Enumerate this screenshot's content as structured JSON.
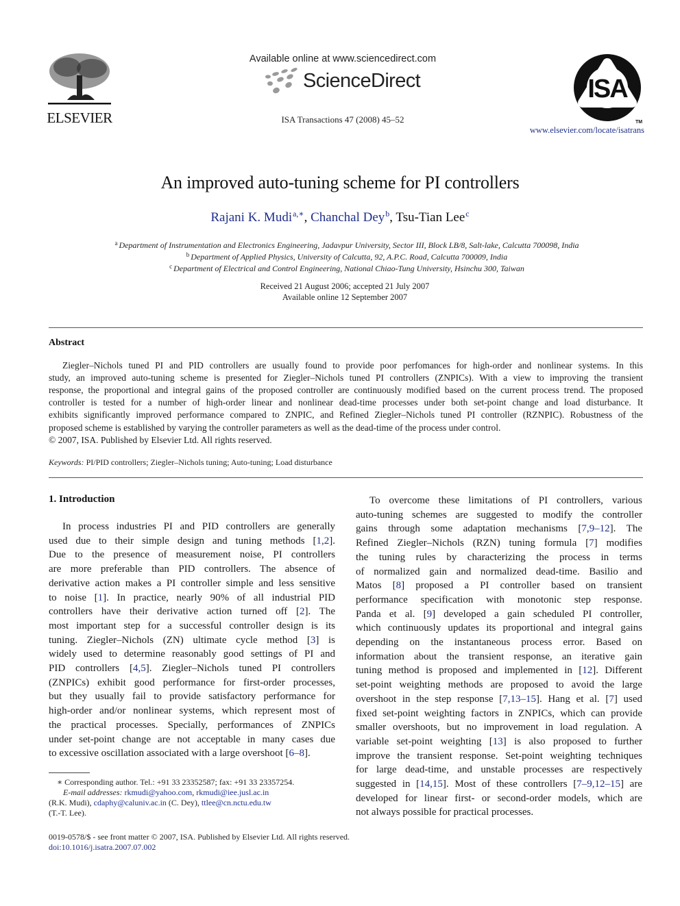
{
  "header": {
    "publisher": "ELSEVIER",
    "available_online": "Available online at www.sciencedirect.com",
    "sciencedirect_brand": "ScienceDirect",
    "journal_ref": "ISA Transactions 47 (2008) 45–52",
    "isa_logo_text": "ISA",
    "isa_tm": "TM",
    "journal_url": "www.elsevier.com/locate/isatrans"
  },
  "article": {
    "title": "An improved auto-tuning scheme for PI controllers",
    "authors": [
      {
        "name": "Rajani K. Mudi",
        "sup": "a,∗",
        "linked": true
      },
      {
        "name": "Chanchal Dey",
        "sup": "b",
        "linked": true
      },
      {
        "name": "Tsu-Tian Lee",
        "sup": "c",
        "linked": false
      }
    ],
    "affiliations": [
      {
        "sup": "a",
        "text": "Department of Instrumentation and Electronics Engineering, Jadavpur University, Sector III, Block LB/8, Salt-lake, Calcutta 700098, India"
      },
      {
        "sup": "b",
        "text": "Department of Applied Physics, University of Calcutta, 92, A.P.C. Road, Calcutta 700009, India"
      },
      {
        "sup": "c",
        "text": "Department of Electrical and Control Engineering, National Chiao-Tung University, Hsinchu 300, Taiwan"
      }
    ],
    "received": "Received 21 August 2006; accepted 21 July 2007",
    "available": "Available online 12 September 2007"
  },
  "abstract": {
    "heading": "Abstract",
    "lines": [
      "Ziegler–Nichols tuned PI and PID controllers are usually found to provide poor perfomances for high-order and nonlinear systems. In this",
      "study, an improved auto-tuning scheme is presented for Ziegler–Nichols tuned PI controllers (ZNPICs). With a view to improving the transient",
      "response, the proportional and integral gains of the proposed controller are continuously modified based on the current process trend. The proposed",
      "controller is tested for a number of high-order linear and nonlinear dead-time processes under both set-point change and load disturbance. It",
      "exhibits significantly improved performance compared to ZNPIC, and Refined Ziegler–Nichols tuned PI controller (RZNPIC). Robustness of the",
      "proposed scheme is established by varying the controller parameters as well as the dead-time of the process under control.",
      "© 2007, ISA. Published by Elsevier Ltd. All rights reserved."
    ],
    "keywords_label": "Keywords:",
    "keywords": "PI/PID controllers; Ziegler–Nichols tuning; Auto-tuning; Load disturbance"
  },
  "section": {
    "heading": "1.  Introduction",
    "left_lines": [
      "In process industries PI and PID controllers are generally",
      "used due to their simple design and tuning methods [1,2].",
      "Due to the presence of measurement noise, PI controllers",
      "are more preferable than PID controllers. The absence of",
      "derivative action makes a PI controller simple and less sensitive",
      "to noise [1]. In practice, nearly 90% of all industrial PID",
      "controllers have their derivative action turned off [2]. The",
      "most important step for a successful controller design is its",
      "tuning. Ziegler–Nichols (ZN) ultimate cycle method [3] is",
      "widely used to determine reasonably good settings of PI and",
      "PID controllers [4,5]. Ziegler–Nichols tuned PI controllers",
      "(ZNPICs) exhibit good performance for first-order processes,",
      "but they usually fail to provide satisfactory performance for",
      "high-order and/or nonlinear systems, which represent most of",
      "the practical processes. Specially, performances of ZNPICs",
      "under set-point change are not acceptable in many cases due",
      "to excessive oscillation associated with a large overshoot [6–8]."
    ],
    "right_lines": [
      "To overcome these limitations of PI controllers, various",
      "auto-tuning schemes are suggested to modify the controller",
      "gains through some adaptation mechanisms [7,9–12]. The",
      "Refined Ziegler–Nichols (RZN) tuning formula [7] modifies",
      "the tuning rules by characterizing the process in terms",
      "of normalized gain and normalized dead-time. Basilio and",
      "Matos [8] proposed a PI controller based on transient",
      "performance specification with monotonic step response.",
      "Panda et al. [9] developed a gain scheduled PI controller,",
      "which continuously updates its proportional and integral gains",
      "depending on the instantaneous process error. Based on",
      "information about the transient response, an iterative gain",
      "tuning method is proposed and implemented in [12]. Different",
      "set-point weighting methods are proposed to avoid the large",
      "overshoot in the step response [7,13–15]. Hang et al. [7] used",
      "fixed set-point weighting factors in ZNPICs, which can provide",
      "smaller overshoots, but no improvement in load regulation. A",
      "variable set-point weighting [13] is also proposed to further",
      "improve the transient response. Set-point weighting techniques",
      "for large dead-time, and unstable processes are respectively",
      "suggested in [14,15]. Most of these controllers [7–9,12–15] are",
      "developed for linear first- or second-order models, which are",
      "not always possible for practical processes."
    ]
  },
  "footnote": {
    "corresponding": "∗ Corresponding author. Tel.: +91 33 23352587; fax: +91 33 23357254.",
    "email_label": "E-mail addresses:",
    "email1": "rkmudi@yahoo.com",
    "email2": "rkmudi@iee.jusl.ac.in",
    "email_owner1": "(R.K. Mudi),",
    "email3": "cdaphy@caluniv.ac.in",
    "email_owner3": "(C. Dey),",
    "email4": "ttlee@cn.nctu.edu.tw",
    "email_owner4": "(T.-T. Lee)."
  },
  "footer": {
    "front_matter": "0019-0578/$ - see front matter © 2007, ISA. Published by Elsevier Ltd. All rights reserved.",
    "doi": "doi:10.1016/j.isatra.2007.07.002"
  },
  "colors": {
    "link": "#1f2f8a",
    "text": "#1a1a1a",
    "rule": "#555555"
  }
}
